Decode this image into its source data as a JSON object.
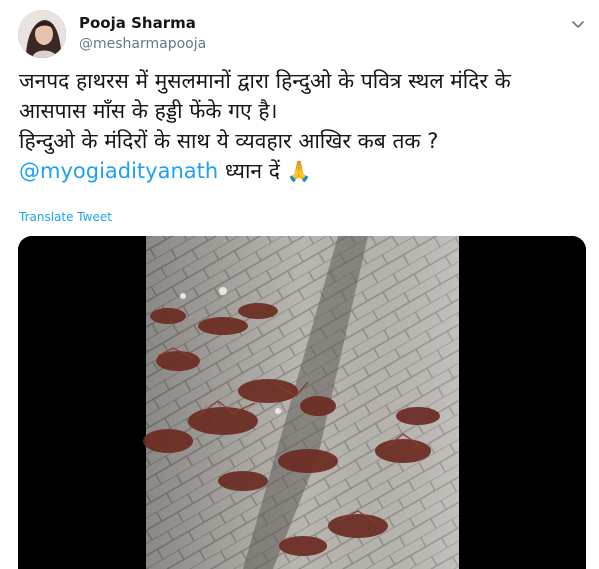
{
  "user": {
    "display_name": "Pooja Sharma",
    "handle": "@mesharmapooja"
  },
  "tweet": {
    "line1": "जनपद हाथरस में मुसलमानों द्वारा हिन्दुओ के पवित्र स्थल मंदिर के",
    "line2": "आसपास माँस के हड्डी फेंके गए है।",
    "line3": "हिन्दुओ के मंदिरों के साथ ये व्यवहार आखिर कब तक ?",
    "mention": "@myogiadityanath",
    "line4_rest": " ध्यान दें ",
    "emoji": "🙏"
  },
  "translate_label": "Translate Tweet",
  "icons": {
    "caret": "chevron-down-icon",
    "emoji": "folded-hands-icon"
  },
  "colors": {
    "link": "#1da1f2",
    "text": "#14171a",
    "secondary": "#657786"
  }
}
